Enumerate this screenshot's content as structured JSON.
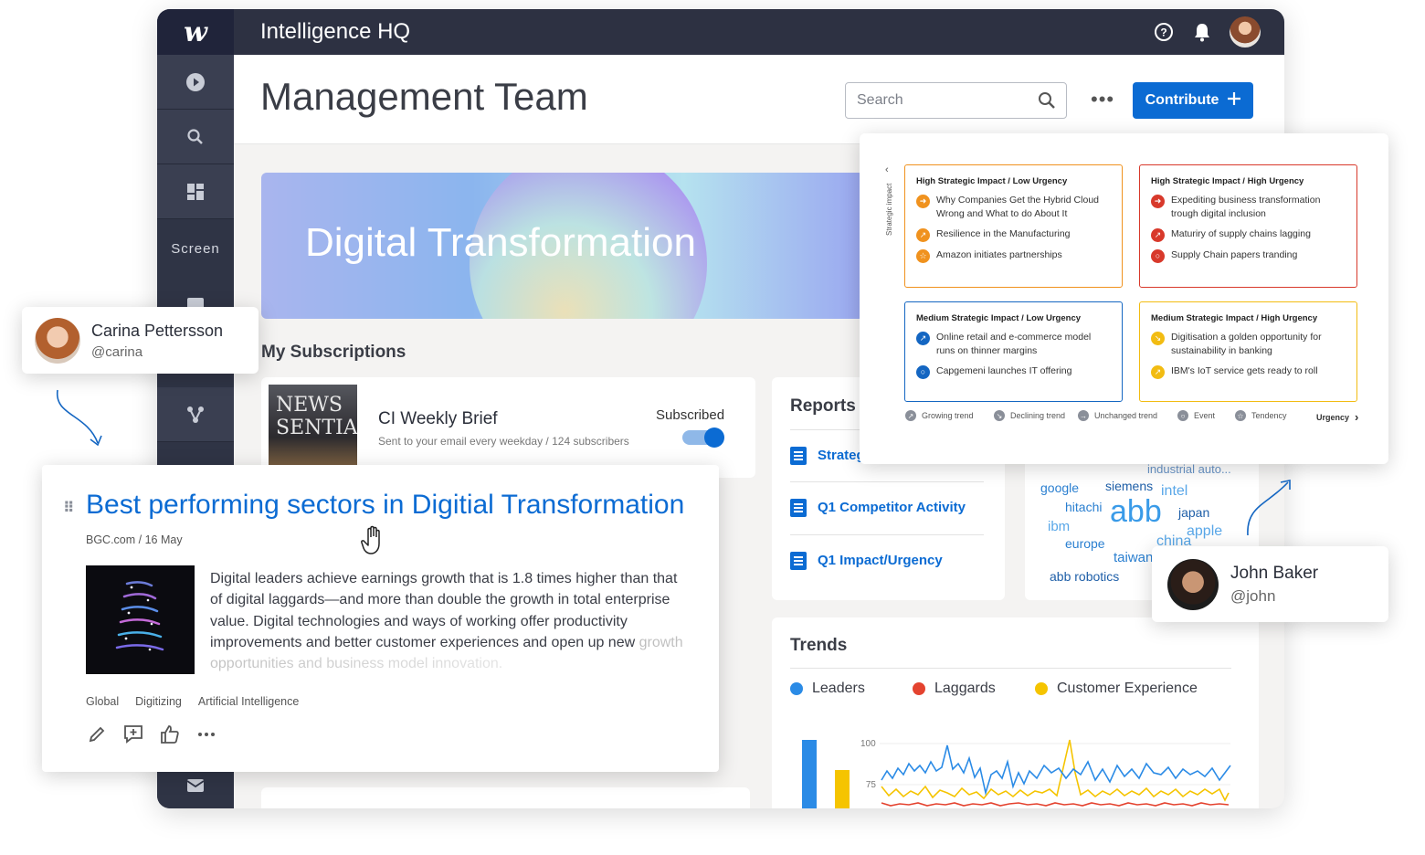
{
  "app": {
    "logo_glyph": "w",
    "title": "Intelligence HQ",
    "sidebar_screen_label": "Screen"
  },
  "header": {
    "page_title": "Management Team",
    "search_placeholder": "Search",
    "more_label": "•••",
    "contribute_label": "Contribute"
  },
  "hero": {
    "title": "Digital Transformation"
  },
  "subscriptions": {
    "section_title": "My Subscriptions",
    "thumb_text": "NEWS SENTIAL",
    "item_title": "CI Weekly Brief",
    "item_meta": "Sent to your email every weekday  /  124 subscribers",
    "status_label": "Subscribed",
    "subscribed": true
  },
  "reports": {
    "title": "Reports",
    "items": [
      {
        "label": "Strategic Matrix"
      },
      {
        "label": "Q1 Competitor Activity"
      },
      {
        "label": "Q1 Impact/Urgency"
      }
    ]
  },
  "word_cloud": {
    "words": [
      "industrial auto...",
      "google",
      "siemens",
      "intel",
      "hitachi",
      "abb",
      "japan",
      "ibm",
      "europe",
      "china",
      "apple",
      "taiwan",
      "abb robotics"
    ]
  },
  "trends": {
    "title": "Trends",
    "legend": [
      {
        "name": "Leaders",
        "color": "#2b8be6"
      },
      {
        "name": "Laggards",
        "color": "#e4432f"
      },
      {
        "name": "Customer Experience",
        "color": "#f5c400"
      }
    ],
    "ticks": [
      "100",
      "75"
    ]
  },
  "matrix": {
    "axis_vertical": "Strategic impact",
    "axis_horizontal": "Urgency",
    "quadrants": [
      {
        "title": "High Strategic Impact / Low Urgency",
        "color": "#f0921e",
        "items": [
          "Why Companies Get the Hybrid Cloud Wrong and What to do About It",
          "Resilience in the Manufacturing",
          "Amazon initiates partnerships"
        ]
      },
      {
        "title": "High Strategic Impact / High Urgency",
        "color": "#d8392b",
        "items": [
          "Expediting business transformation trough digital inclusion",
          "Maturiry of supply chains lagging",
          "Supply Chain papers tranding"
        ]
      },
      {
        "title": "Medium Strategic Impact / Low Urgency",
        "color": "#1466c2",
        "items": [
          "Online retail and e-commerce model runs on thinner margins",
          "Capgemeni launches IT offering"
        ]
      },
      {
        "title": "Medium Strategic Impact / High Urgency",
        "color": "#f2bc12",
        "items": [
          "Digitisation a golden opportunity for sustainability in banking",
          "IBM's IoT service gets ready to roll"
        ]
      }
    ],
    "legend": [
      "Growing trend",
      "Declining trend",
      "Unchanged trend",
      "Event",
      "Tendency"
    ]
  },
  "profiles": {
    "carina": {
      "name": "Carina Pettersson",
      "handle": "@carina"
    },
    "john": {
      "name": "John Baker",
      "handle": "@john"
    }
  },
  "article": {
    "drag_label": "⠿",
    "title": "Best performing sectors in Digitial Transformation",
    "meta": "BGC.com  /  16 May",
    "body": "Digital leaders achieve earnings growth that is 1.8 times higher than that of digital laggards—and more than double the growth in total enterprise value. Digital technologies and ways of working offer productivity improvements and better customer experiences and open up new",
    "body_fade": "growth opportunities and business model innovation.",
    "tags": [
      "Global",
      "Digitizing",
      "Artificial Intelligence"
    ],
    "actions": [
      "edit-icon",
      "comment-add-icon",
      "thumbs-up-icon",
      "more-icon"
    ]
  }
}
